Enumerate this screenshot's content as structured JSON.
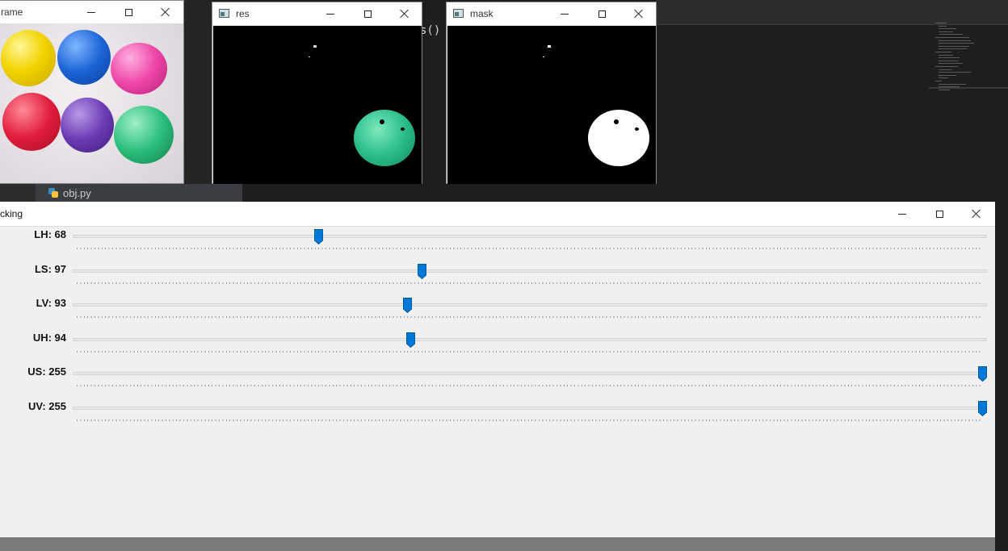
{
  "editor": {
    "code_fragment": "s()",
    "tab_label": "obj.py"
  },
  "windows": {
    "frame": {
      "title": "rame"
    },
    "res": {
      "title": "res"
    },
    "mask": {
      "title": "mask"
    }
  },
  "tracking": {
    "title": "cking",
    "max": 255,
    "trackbars": [
      {
        "label": "LH: 68",
        "value": 68
      },
      {
        "label": "LS: 97",
        "value": 97
      },
      {
        "label": "LV: 93",
        "value": 93
      },
      {
        "label": "UH: 94",
        "value": 94
      },
      {
        "label": "US: 255",
        "value": 255
      },
      {
        "label": "UV: 255",
        "value": 255
      }
    ]
  },
  "colors": {
    "thumb": "#0078d7",
    "green_ball": "#2bbf8a"
  },
  "icons": [
    "python-file-icon",
    "app-window-icon",
    "minimize-icon",
    "maximize-icon",
    "close-icon"
  ]
}
